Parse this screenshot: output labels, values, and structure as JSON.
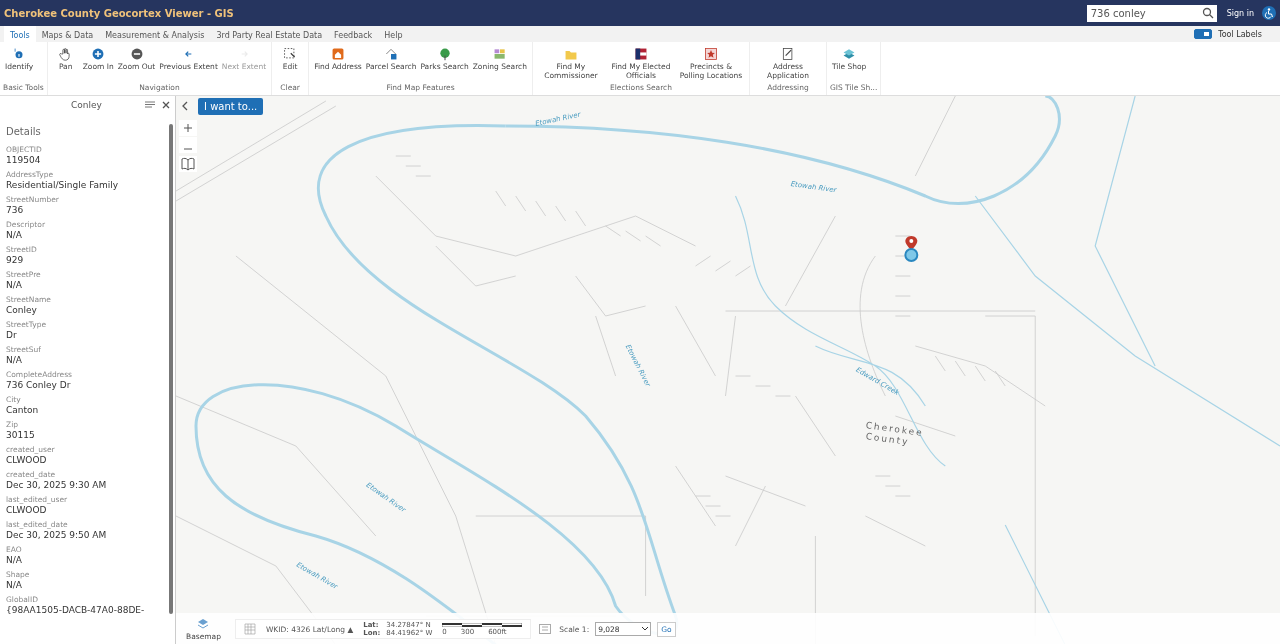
{
  "header": {
    "title": "Cherokee County Geocortex Viewer - GIS",
    "search": {
      "value": "736 conley"
    },
    "sign_in": "Sign in"
  },
  "tabs": [
    {
      "label": "Tools",
      "selected": true
    },
    {
      "label": "Maps & Data",
      "selected": false
    },
    {
      "label": "Measurement & Analysis",
      "selected": false
    },
    {
      "label": "3rd Party Real Estate Data",
      "selected": false
    },
    {
      "label": "Feedback",
      "selected": false
    },
    {
      "label": "Help",
      "selected": false
    }
  ],
  "tool_labels": {
    "label": "Tool Labels",
    "checked": true
  },
  "toolbar_groups": [
    {
      "label": "Basic Tools",
      "tools": [
        {
          "label": "Identify",
          "disabled": false
        }
      ]
    },
    {
      "label": "Navigation",
      "tools": [
        {
          "label": "Pan",
          "disabled": false
        },
        {
          "label": "Zoom In",
          "disabled": false
        },
        {
          "label": "Zoom Out",
          "disabled": false
        },
        {
          "label": "Previous Extent",
          "disabled": false
        },
        {
          "label": "Next Extent",
          "disabled": true
        }
      ]
    },
    {
      "label": "Clear",
      "tools": [
        {
          "label": "Edit",
          "disabled": false
        }
      ]
    },
    {
      "label": "Find Map Features",
      "tools": [
        {
          "label": "Find Address",
          "disabled": false
        },
        {
          "label": "Parcel Search",
          "disabled": false
        },
        {
          "label": "Parks Search",
          "disabled": false
        },
        {
          "label": "Zoning Search",
          "disabled": false
        }
      ]
    },
    {
      "label": "Elections Search",
      "tools": [
        {
          "label": "Find My Commissioner",
          "disabled": false
        },
        {
          "label": "Find My Elected Officials",
          "disabled": false
        },
        {
          "label": "Precincts & Polling Locations",
          "disabled": false
        }
      ]
    },
    {
      "label": "Addressing",
      "tools": [
        {
          "label": "Address Application",
          "disabled": false
        }
      ]
    },
    {
      "label": "GIS Tile Sh...",
      "tools": [
        {
          "label": "Tile Shop",
          "disabled": false
        }
      ]
    }
  ],
  "details_panel": {
    "title": "Conley",
    "heading": "Details",
    "fields": [
      {
        "name": "OBJECTID",
        "value": "119504"
      },
      {
        "name": "AddressType",
        "value": "Residential/Single Family"
      },
      {
        "name": "StreetNumber",
        "value": "736"
      },
      {
        "name": "Descriptor",
        "value": "N/A"
      },
      {
        "name": "StreetID",
        "value": "929"
      },
      {
        "name": "StreetPre",
        "value": "N/A"
      },
      {
        "name": "StreetName",
        "value": "Conley"
      },
      {
        "name": "StreetType",
        "value": "Dr"
      },
      {
        "name": "StreetSuf",
        "value": "N/A"
      },
      {
        "name": "CompleteAddress",
        "value": "736 Conley Dr"
      },
      {
        "name": "City",
        "value": "Canton"
      },
      {
        "name": "Zip",
        "value": "30115"
      },
      {
        "name": "created_user",
        "value": "CLWOOD"
      },
      {
        "name": "created_date",
        "value": "Dec 30, 2025 9:30 AM"
      },
      {
        "name": "last_edited_user",
        "value": "CLWOOD"
      },
      {
        "name": "last_edited_date",
        "value": "Dec 30, 2025 9:50 AM"
      },
      {
        "name": "EAO",
        "value": "N/A"
      },
      {
        "name": "Shape",
        "value": "N/A"
      },
      {
        "name": "GlobalID",
        "value": "{98AA1505-DACB-47A0-88DE-"
      }
    ]
  },
  "map": {
    "i_want_to": "I want to...",
    "labels": [
      {
        "text": "Etowah River",
        "kind": "water"
      },
      {
        "text": "Etowah River",
        "kind": "water"
      },
      {
        "text": "Etowah River",
        "kind": "water"
      },
      {
        "text": "Etowah River",
        "kind": "water"
      },
      {
        "text": "Etowah River",
        "kind": "water"
      },
      {
        "text": "Edward Creek",
        "kind": "water"
      },
      {
        "text": "Cherokee",
        "kind": "area"
      },
      {
        "text": "County",
        "kind": "area"
      }
    ]
  },
  "status_bar": {
    "basemap": "Basemap",
    "wkid": "WKID: 4326 Lat/Long ▲",
    "lat_label": "Lat:",
    "lat": "34.27847° N",
    "lon_label": "Lon:",
    "lon": "84.41962° W",
    "scale_ticks": [
      "0",
      "300",
      "600ft"
    ],
    "scale_label": "Scale 1:",
    "scale_value": "9,028",
    "go": "Go"
  }
}
